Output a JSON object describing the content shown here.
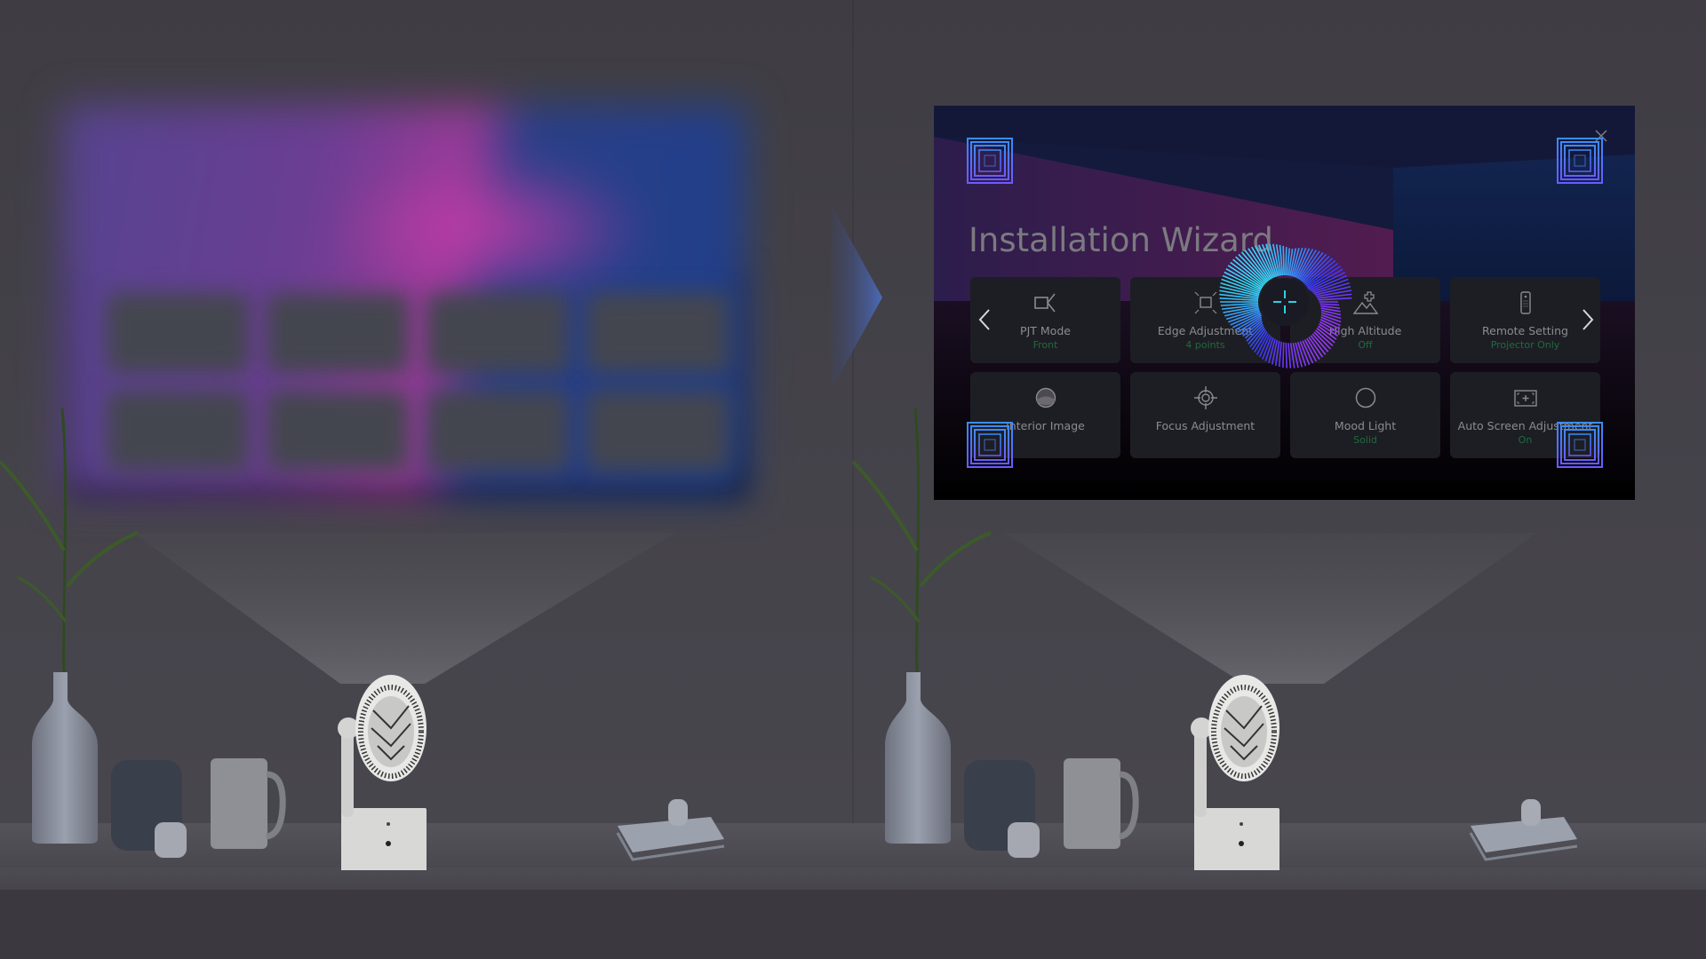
{
  "scene": {
    "description_left": "Projector with blurred projected image",
    "description_right": "Projector with Installation Wizard projected"
  },
  "wizard": {
    "title": "Installation Wizard",
    "close_icon": "close-icon",
    "prev_icon": "chevron-left-icon",
    "next_icon": "chevron-right-icon",
    "focus_overlay_icon": "crosshair-icon",
    "tiles": [
      {
        "label": "PJT Mode",
        "value": "Front",
        "icon": "projector-mode-icon"
      },
      {
        "label": "Edge Adjustment",
        "value": "4 points",
        "icon": "edge-adjust-icon"
      },
      {
        "label": "High Altitude",
        "value": "Off",
        "icon": "mountain-icon"
      },
      {
        "label": "Remote Setting",
        "value": "Projector Only",
        "icon": "remote-icon"
      },
      {
        "label": "Interior Image",
        "value": "",
        "icon": "interior-image-icon"
      },
      {
        "label": "Focus Adjustment",
        "value": "",
        "icon": "focus-target-icon"
      },
      {
        "label": "Mood Light",
        "value": "Solid",
        "icon": "circle-icon"
      },
      {
        "label": "Auto Screen Adjustment",
        "value": "On",
        "icon": "auto-screen-icon"
      }
    ]
  },
  "colors": {
    "background": "#3e3c42",
    "tile": "#1d1e23",
    "tile_label": "#8b8b90",
    "tile_value": "#1e6b3e",
    "marker_top": "#3a8cff",
    "marker_bottom": "#6a5cff",
    "crosshair": "#2ad4e0"
  }
}
